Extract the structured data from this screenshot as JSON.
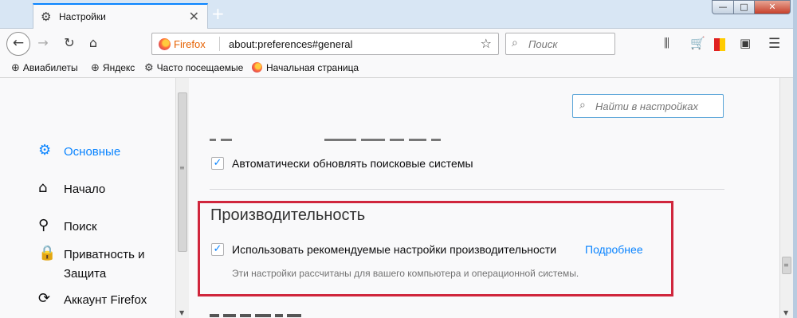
{
  "tab": {
    "title": "Настройки",
    "icon": "gear-icon"
  },
  "window_controls": {
    "minimize": "—",
    "maximize": "□",
    "close": "✕"
  },
  "nav": {
    "identity_label": "Firefox",
    "url": "about:preferences#general",
    "search_placeholder": "Поиск"
  },
  "bookmarks": [
    {
      "label": "Авиабилеты",
      "icon": "globe-icon"
    },
    {
      "label": "Яндекс",
      "icon": "globe-icon"
    },
    {
      "label": "Часто посещаемые",
      "icon": "gear-icon"
    },
    {
      "label": "Начальная страница",
      "icon": "firefox-icon"
    }
  ],
  "sidebar": {
    "items": [
      {
        "label": "Основные",
        "icon": "gear-icon",
        "active": true
      },
      {
        "label": "Начало",
        "icon": "home-icon"
      },
      {
        "label": "Поиск",
        "icon": "search-icon"
      },
      {
        "label": "Приватность и Защита",
        "icon": "lock-icon"
      },
      {
        "label": "Аккаунт Firefox",
        "icon": "sync-icon"
      }
    ]
  },
  "main": {
    "find_placeholder": "Найти в настройках",
    "search_engines_update": {
      "label": "Автоматически обновлять поисковые системы",
      "checked": true
    },
    "performance": {
      "title": "Производительность",
      "use_recommended": {
        "label": "Использовать рекомендуемые настройки производительности",
        "checked": true
      },
      "learn_more": "Подробнее",
      "hint": "Эти настройки рассчитаны для вашего компьютера и операционной системы."
    }
  },
  "colors": {
    "accent": "#0a84ff",
    "highlight_border": "#d0263c"
  }
}
